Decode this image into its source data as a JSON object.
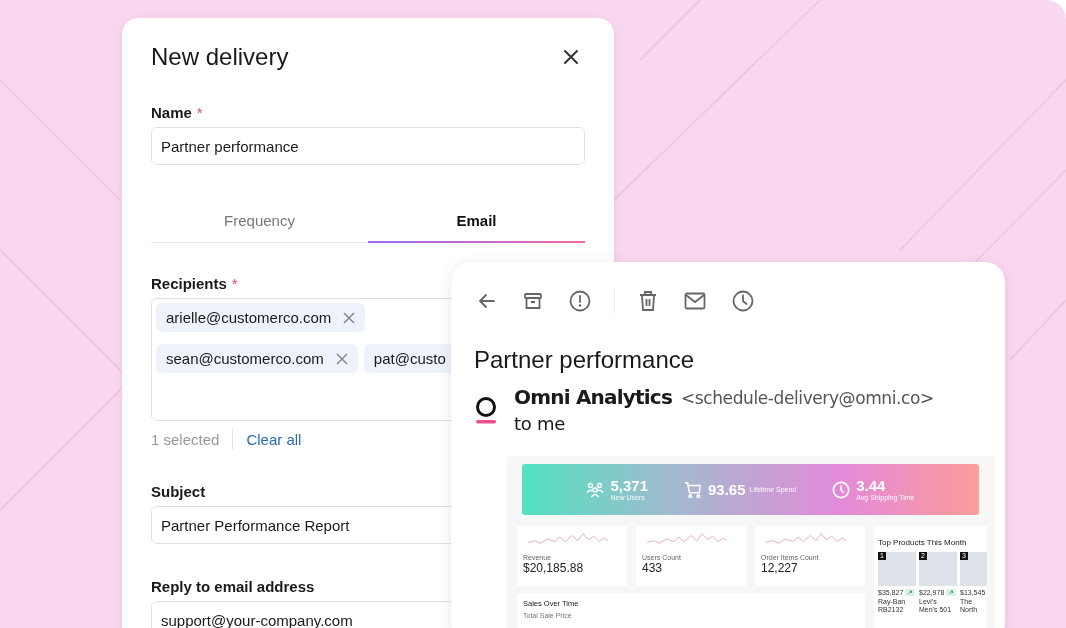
{
  "dialog": {
    "title": "New delivery"
  },
  "name_field": {
    "label": "Name",
    "required_mark": "*",
    "value": "Partner performance"
  },
  "tabs": [
    {
      "label": "Frequency",
      "selected": false
    },
    {
      "label": "Email",
      "selected": true
    }
  ],
  "recipients": {
    "label": "Recipients",
    "required_mark": "*",
    "chips": [
      {
        "email": "arielle@customerco.com",
        "remove_button": true
      },
      {
        "email": "sean@customerco.com",
        "remove_button": true
      },
      {
        "email": "pat@custo",
        "remove_button": false
      }
    ],
    "selected_count": "1 selected",
    "clear_link": "Clear all"
  },
  "subject": {
    "label": "Subject",
    "value": "Partner Performance Report"
  },
  "reply_to": {
    "label": "Reply to email address",
    "value": "support@your-company.com"
  },
  "email": {
    "subject": "Partner performance",
    "sender_name": "Omni Analytics",
    "sender_address": "<schedule-delivery@omni.co>",
    "recipient": "to me",
    "report": {
      "kpis": [
        {
          "kind": "users",
          "value": "5,371",
          "label": "New Users"
        },
        {
          "kind": "cart",
          "value": "93.65",
          "label": "Lifetime Spend"
        },
        {
          "kind": "clock",
          "value": "3.44",
          "label": "Avg Shipping Time"
        }
      ],
      "metrics": [
        {
          "label": "Revenue",
          "value": "$20,185.88"
        },
        {
          "label": "Users Count",
          "value": "433"
        },
        {
          "label": "Order Items Count",
          "value": "12,227"
        }
      ],
      "sales": {
        "title": "Sales Over Time",
        "subtitle": "Total Sale Price"
      },
      "top_products": {
        "title": "Top Products This Month",
        "items": [
          {
            "rank": "1",
            "price": "$35,827",
            "trend_badge": true,
            "name": "Ray-Ban RB2132"
          },
          {
            "rank": "2",
            "price": "$22,978",
            "trend_badge": true,
            "name": "Levi's Men's 501"
          },
          {
            "rank": "3",
            "price": "$13,545",
            "name": "The North"
          }
        ]
      }
    }
  }
}
